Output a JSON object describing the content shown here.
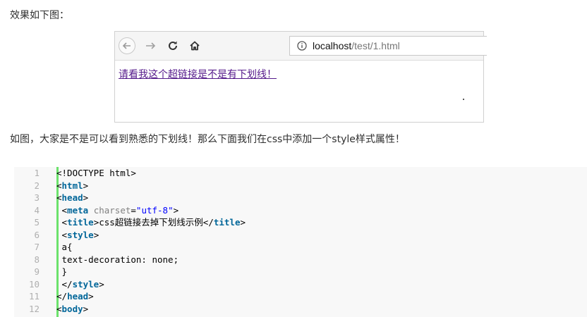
{
  "intro_text": "效果如下图：",
  "browser": {
    "url_host": "localhost",
    "url_path": "/test/1.html",
    "link_text": "请看我这个超链接是不是有下划线！"
  },
  "after_text": "如图，大家是不是可以看到熟悉的下划线！那么下面我们在css中添加一个style样式属性！",
  "code_lines": [
    {
      "n": "1",
      "segments": [
        {
          "t": "<!DOCTYPE html>",
          "c": ""
        }
      ]
    },
    {
      "n": "2",
      "segments": [
        {
          "t": "<",
          "c": ""
        },
        {
          "t": "html",
          "c": "kw"
        },
        {
          "t": ">",
          "c": ""
        }
      ]
    },
    {
      "n": "3",
      "segments": [
        {
          "t": "<",
          "c": ""
        },
        {
          "t": "head",
          "c": "kw"
        },
        {
          "t": ">",
          "c": ""
        }
      ]
    },
    {
      "n": "4",
      "segments": [
        {
          "t": " <",
          "c": ""
        },
        {
          "t": "meta",
          "c": "kw"
        },
        {
          "t": " ",
          "c": ""
        },
        {
          "t": "charset",
          "c": "attr"
        },
        {
          "t": "=",
          "c": ""
        },
        {
          "t": "\"utf-8\"",
          "c": "str"
        },
        {
          "t": ">",
          "c": ""
        }
      ]
    },
    {
      "n": "5",
      "segments": [
        {
          "t": " <",
          "c": ""
        },
        {
          "t": "title",
          "c": "kw"
        },
        {
          "t": ">css超链接去掉下划线示例</",
          "c": ""
        },
        {
          "t": "title",
          "c": "kw"
        },
        {
          "t": ">",
          "c": ""
        }
      ]
    },
    {
      "n": "6",
      "segments": [
        {
          "t": " <",
          "c": ""
        },
        {
          "t": "style",
          "c": "kw"
        },
        {
          "t": ">",
          "c": ""
        }
      ]
    },
    {
      "n": "7",
      "segments": [
        {
          "t": " a{",
          "c": ""
        }
      ]
    },
    {
      "n": "8",
      "segments": [
        {
          "t": " text-decoration: none;",
          "c": ""
        }
      ]
    },
    {
      "n": "9",
      "segments": [
        {
          "t": " }",
          "c": ""
        }
      ]
    },
    {
      "n": "10",
      "segments": [
        {
          "t": " </",
          "c": ""
        },
        {
          "t": "style",
          "c": "kw"
        },
        {
          "t": ">",
          "c": ""
        }
      ]
    },
    {
      "n": "11",
      "segments": [
        {
          "t": "</",
          "c": ""
        },
        {
          "t": "head",
          "c": "kw"
        },
        {
          "t": ">",
          "c": ""
        }
      ]
    },
    {
      "n": "12",
      "segments": [
        {
          "t": "<",
          "c": ""
        },
        {
          "t": "body",
          "c": "kw"
        },
        {
          "t": ">",
          "c": ""
        }
      ]
    }
  ]
}
